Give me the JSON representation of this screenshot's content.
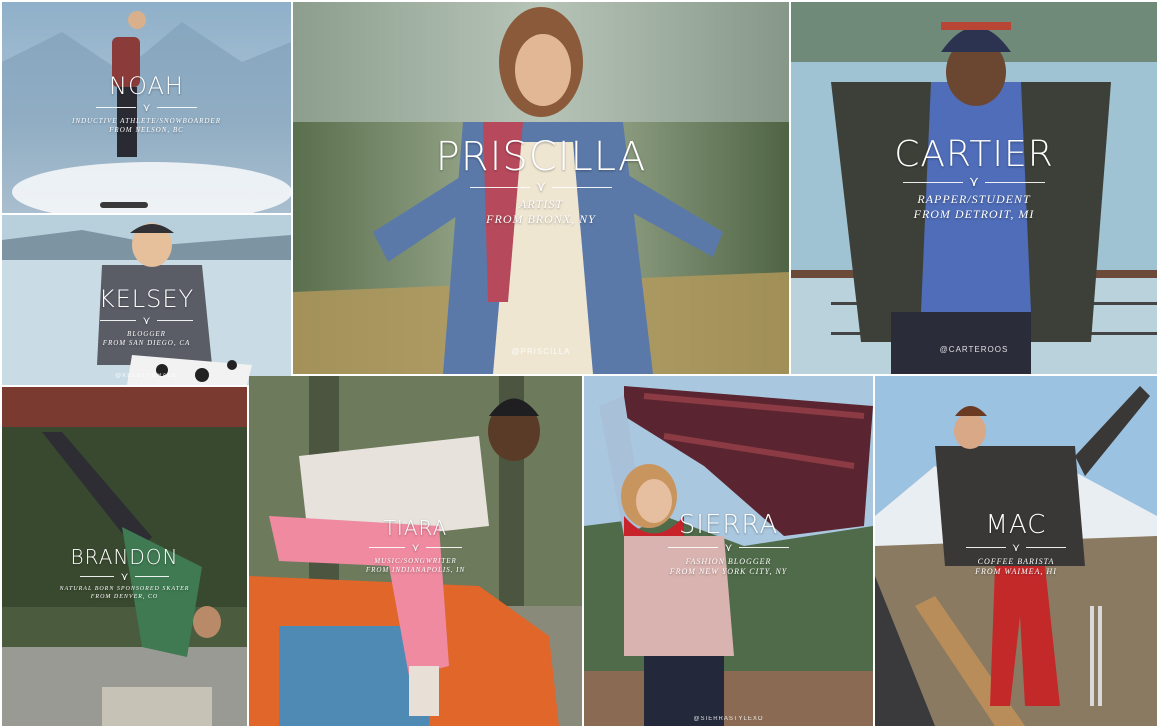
{
  "profiles": [
    {
      "name": "NOAH",
      "subtitle_line1": "INDUCTIVE ATHLETE/SNOWBOARDER",
      "subtitle_line2": "FROM NELSON, BC",
      "handle": ""
    },
    {
      "name": "PRISCILLA",
      "subtitle_line1": "ARTIST",
      "subtitle_line2": "FROM BRONX, NY",
      "handle": "@PRISCILLA"
    },
    {
      "name": "CARTIER",
      "subtitle_line1": "RAPPER/STUDENT",
      "subtitle_line2": "FROM DETROIT, MI",
      "handle": "@CARTEROOS"
    },
    {
      "name": "KELSEY",
      "subtitle_line1": "BLOGGER",
      "subtitle_line2": "FROM SAN DIEGO, CA",
      "handle": "@KELSEYGRACE"
    },
    {
      "name": "BRANDON",
      "subtitle_line1": "NATURAL BORN SPONSORED SKATER",
      "subtitle_line2": "FROM DENVER, CO",
      "handle": ""
    },
    {
      "name": "TIARA",
      "subtitle_line1": "MUSIC/SONGWRITER",
      "subtitle_line2": "FROM INDIANAPOLIS, IN",
      "handle": ""
    },
    {
      "name": "SIERRA",
      "subtitle_line1": "FASHION BLOGGER",
      "subtitle_line2": "FROM NEW YORK CITY, NY",
      "handle": "@SIERRASTYLEXO"
    },
    {
      "name": "MAC",
      "subtitle_line1": "COFFEE BARISTA",
      "subtitle_line2": "FROM WAIMEA, HI",
      "handle": ""
    }
  ]
}
